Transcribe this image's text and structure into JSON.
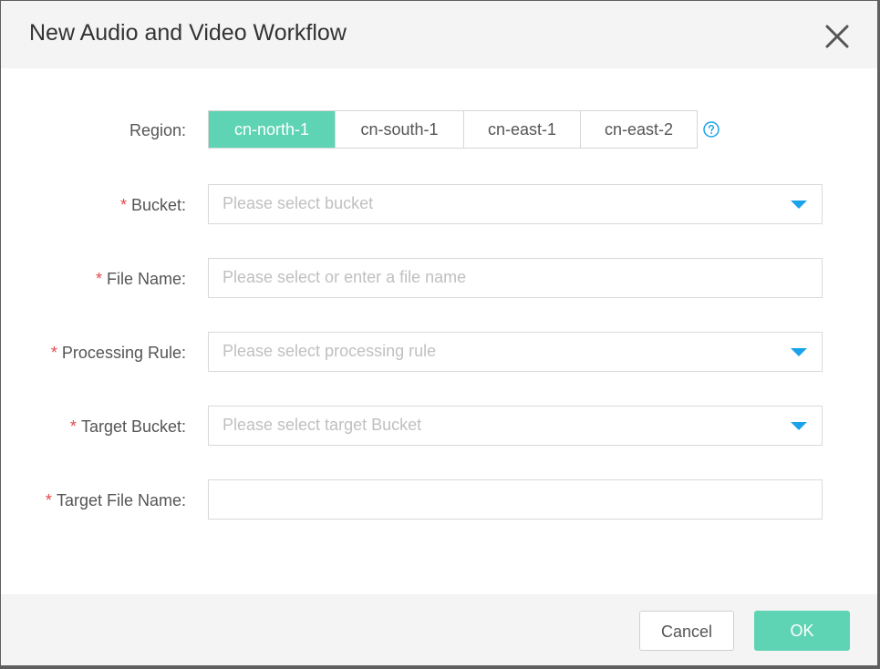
{
  "dialog": {
    "title": "New Audio and Video Workflow",
    "close_icon": "close-icon"
  },
  "form": {
    "region": {
      "label": "Region:",
      "options": [
        "cn-north-1",
        "cn-south-1",
        "cn-east-1",
        "cn-east-2"
      ],
      "selected": "cn-north-1",
      "help_icon": "question-circle-icon"
    },
    "bucket": {
      "required_mark": "*",
      "label": "Bucket:",
      "placeholder": "Please select bucket",
      "icon": "caret-down-icon"
    },
    "file_name": {
      "required_mark": "*",
      "label": "File Name:",
      "placeholder": "Please select or enter a file name"
    },
    "processing_rule": {
      "required_mark": "*",
      "label": "Processing Rule:",
      "placeholder": "Please select processing rule",
      "icon": "caret-down-icon"
    },
    "target_bucket": {
      "required_mark": "*",
      "label": "Target Bucket:",
      "placeholder": "Please select target Bucket",
      "icon": "caret-down-icon"
    },
    "target_file_name": {
      "required_mark": "*",
      "label": "Target File Name:",
      "value": ""
    }
  },
  "footer": {
    "cancel_label": "Cancel",
    "ok_label": "OK"
  },
  "colors": {
    "accent": "#5fd4b4",
    "required": "#e5484d",
    "caret": "#1aa3e8",
    "help": "#1aa3e8"
  }
}
